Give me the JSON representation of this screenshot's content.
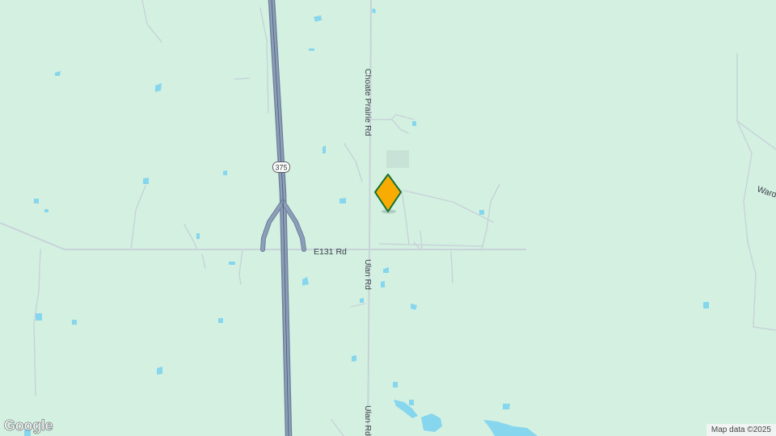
{
  "map": {
    "roads": {
      "choate_prairie": "Choate Prairie Rd",
      "ulan_upper": "Ulan Rd",
      "ulan_lower": "Ulan Rd",
      "e131": "E131 Rd",
      "ward": "Ward"
    },
    "highway_shield": "375",
    "marker": {
      "name": "location-marker",
      "fill": "#f9ab00",
      "stroke": "#137333"
    },
    "colors": {
      "land": "#d3f0e1",
      "water": "#86d6ee",
      "highway": "#8c9eb8",
      "minor_road": "#c4d0d6"
    }
  },
  "footer": {
    "logo": "Google",
    "attribution": "Map data ©2025"
  }
}
